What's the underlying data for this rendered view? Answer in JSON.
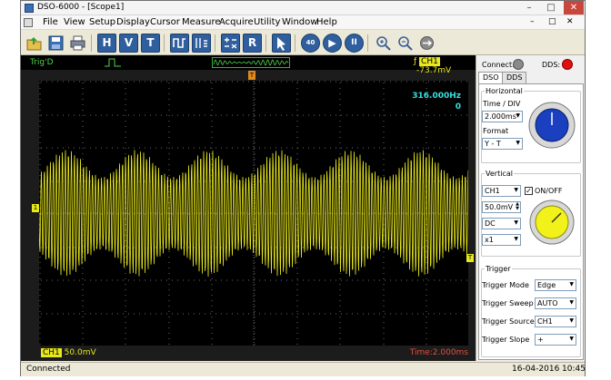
{
  "window": {
    "title": "DSO-6000 - [Scope1]",
    "controls": [
      "–",
      "□",
      "✕"
    ]
  },
  "menu": [
    "File",
    "View",
    "Setup",
    "Display",
    "Cursor",
    "Measure",
    "Acquire",
    "Utility",
    "Window",
    "Help"
  ],
  "menu_controls": [
    "–",
    "□",
    "✕"
  ],
  "toolbar": {
    "h_label": "H",
    "v_label": "V",
    "t_label": "T",
    "r_label": "R",
    "stop_label": "40 OU",
    "run_label": "▶",
    "pause_label": "II"
  },
  "scope": {
    "trig_status": "Trig'D",
    "channel_tag": "CH1",
    "trigger_level": "-73.7mV",
    "trigger_marker": "T",
    "channel_marker": "1",
    "frequency": "316.000Hz",
    "frequency_sub": "0",
    "scale_channel": "CH1",
    "scale_value": "50.0mV",
    "time_value": "Time:2.000ms"
  },
  "panel": {
    "connect_label": "Connect:",
    "dds_label": "DDS:",
    "tabs": [
      "DSO",
      "DDS"
    ],
    "horizontal_title": "Horizontal",
    "time_div_label": "Time / DIV",
    "time_div_value": "2.000ms",
    "format_label": "Format",
    "format_value": "Y - T",
    "vertical_title": "Vertical",
    "channel_value": "CH1",
    "onoff_label": "ON/OFF",
    "volts_value": "50.0mV",
    "coupling_value": "DC",
    "probe_value": "x1",
    "trigger_title": "Trigger",
    "trigger_mode_label": "Trigger Mode",
    "trigger_mode_value": "Edge",
    "trigger_sweep_label": "Trigger Sweep",
    "trigger_sweep_value": "AUTO",
    "trigger_source_label": "Trigger Source",
    "trigger_source_value": "CH1",
    "trigger_slope_label": "Trigger Slope",
    "trigger_slope_value": "+"
  },
  "status": {
    "left": "Connected",
    "date": "16-04-2016",
    "time": "10:45"
  },
  "colors": {
    "trace": "#e8e81c",
    "grid": "#6a6a6a",
    "connect_led": "#8a8a8a",
    "dds_led": "#e01010",
    "time_knob": "#1a3fbf",
    "volt_knob": "#f2f21a",
    "freq_text": "#36e0e0"
  }
}
